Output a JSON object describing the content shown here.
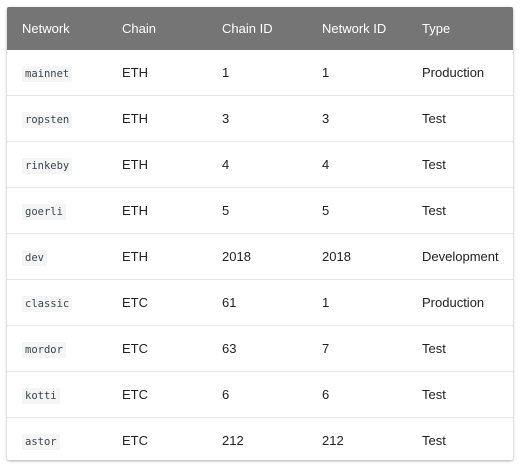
{
  "table": {
    "headers": [
      "Network",
      "Chain",
      "Chain ID",
      "Network ID",
      "Type"
    ],
    "rows": [
      {
        "network": "mainnet",
        "chain": "ETH",
        "chain_id": "1",
        "network_id": "1",
        "type": "Production"
      },
      {
        "network": "ropsten",
        "chain": "ETH",
        "chain_id": "3",
        "network_id": "3",
        "type": "Test"
      },
      {
        "network": "rinkeby",
        "chain": "ETH",
        "chain_id": "4",
        "network_id": "4",
        "type": "Test"
      },
      {
        "network": "goerli",
        "chain": "ETH",
        "chain_id": "5",
        "network_id": "5",
        "type": "Test"
      },
      {
        "network": "dev",
        "chain": "ETH",
        "chain_id": "2018",
        "network_id": "2018",
        "type": "Development"
      },
      {
        "network": "classic",
        "chain": "ETC",
        "chain_id": "61",
        "network_id": "1",
        "type": "Production"
      },
      {
        "network": "mordor",
        "chain": "ETC",
        "chain_id": "63",
        "network_id": "7",
        "type": "Test"
      },
      {
        "network": "kotti",
        "chain": "ETC",
        "chain_id": "6",
        "network_id": "6",
        "type": "Test"
      },
      {
        "network": "astor",
        "chain": "ETC",
        "chain_id": "212",
        "network_id": "212",
        "type": "Test"
      }
    ]
  },
  "colors": {
    "header_bg": "#757575",
    "header_text": "#ffffff",
    "row_divider": "#e8e8e8",
    "code_bg": "#f5f5f5"
  }
}
